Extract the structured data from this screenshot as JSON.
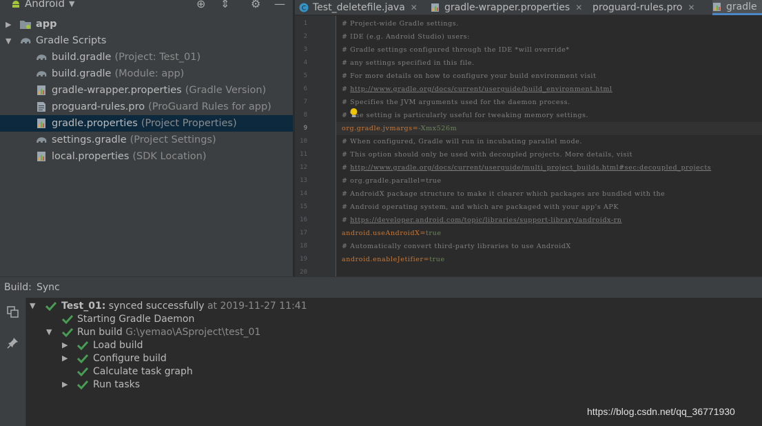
{
  "project_view": {
    "title": "Android",
    "items": [
      {
        "name": "app",
        "hint": "",
        "bold": true
      },
      {
        "name": "Gradle Scripts",
        "hint": ""
      },
      {
        "name": "build.gradle",
        "hint": "(Project: Test_01)"
      },
      {
        "name": "build.gradle",
        "hint": "(Module: app)"
      },
      {
        "name": "gradle-wrapper.properties",
        "hint": "(Gradle Version)"
      },
      {
        "name": "proguard-rules.pro",
        "hint": "(ProGuard Rules for app)"
      },
      {
        "name": "gradle.properties",
        "hint": "(Project Properties)",
        "selected": true
      },
      {
        "name": "settings.gradle",
        "hint": "(Project Settings)"
      },
      {
        "name": "local.properties",
        "hint": "(SDK Location)"
      }
    ]
  },
  "tabs": [
    {
      "label": "Test_deletefile.java",
      "icon": "java-class-icon"
    },
    {
      "label": "gradle-wrapper.properties",
      "icon": "properties-icon"
    },
    {
      "label": "proguard-rules.pro",
      "icon": "properties-icon"
    },
    {
      "label": "gradle",
      "icon": "properties-icon",
      "active": true
    }
  ],
  "editor": {
    "current_line": 9,
    "lines": [
      {
        "n": "1",
        "comment": "# Project-wide Gradle settings."
      },
      {
        "n": "2",
        "comment": "# IDE (e.g. Android Studio) users:"
      },
      {
        "n": "3",
        "comment": "# Gradle settings configured through the IDE *will override*"
      },
      {
        "n": "4",
        "comment": "# any settings specified in this file."
      },
      {
        "n": "5",
        "comment": "# For more details on how to configure your build environment visit"
      },
      {
        "n": "6",
        "comment": "# ",
        "link": "http://www.gradle.org/docs/current/userguide/build_environment.html"
      },
      {
        "n": "7",
        "comment": "# Specifies the JVM arguments used for the daemon process."
      },
      {
        "n": "8",
        "comment": "# The setting is particularly useful for tweaking memory settings."
      },
      {
        "n": "9",
        "key": "org.gradle.jvmargs",
        "value": "-Xmx526m"
      },
      {
        "n": "10",
        "comment": "# When configured, Gradle will run in incubating parallel mode."
      },
      {
        "n": "11",
        "comment": "# This option should only be used with decoupled projects. More details, visit"
      },
      {
        "n": "12",
        "comment": "# ",
        "link": "http://www.gradle.org/docs/current/userguide/multi_project_builds.html#sec:decoupled_projects"
      },
      {
        "n": "13",
        "comment": "# org.gradle.parallel=true"
      },
      {
        "n": "14",
        "comment": "# AndroidX package structure to make it clearer which packages are bundled with the"
      },
      {
        "n": "15",
        "comment": "# Android operating system, and which are packaged with your app's APK"
      },
      {
        "n": "16",
        "comment": "# ",
        "link": "https://developer.android.com/topic/libraries/support-library/androidx-rn"
      },
      {
        "n": "17",
        "key": "android.useAndroidX",
        "value": "true"
      },
      {
        "n": "18",
        "comment": "# Automatically convert third-party libraries to use AndroidX"
      },
      {
        "n": "19",
        "key": "android.enableJetifier",
        "value": "true"
      },
      {
        "n": "20",
        "comment": ""
      }
    ]
  },
  "build": {
    "label": "Build:",
    "tab": "Sync",
    "rows": [
      {
        "title": "Test_01:",
        "text": "synced successfully",
        "dim": "at 2019-11-27 11:41",
        "expanded": true
      },
      {
        "text": "Starting Gradle Daemon",
        "dim": ""
      },
      {
        "text": "Run build",
        "dim": "G:\\yemao\\ASproject\\test_01",
        "expanded": true
      },
      {
        "text": "Load build",
        "dim": "",
        "collapsed": true
      },
      {
        "text": "Configure build",
        "dim": "",
        "collapsed": true
      },
      {
        "text": "Calculate task graph",
        "dim": ""
      },
      {
        "text": "Run tasks",
        "dim": "",
        "collapsed": true
      }
    ]
  },
  "watermark": "https://blog.csdn.net/qq_36771930",
  "colors": {
    "check": "#499c54",
    "selection": "#0d293e",
    "key": "#cc7832",
    "value": "#6a8759",
    "comment": "#808080"
  }
}
